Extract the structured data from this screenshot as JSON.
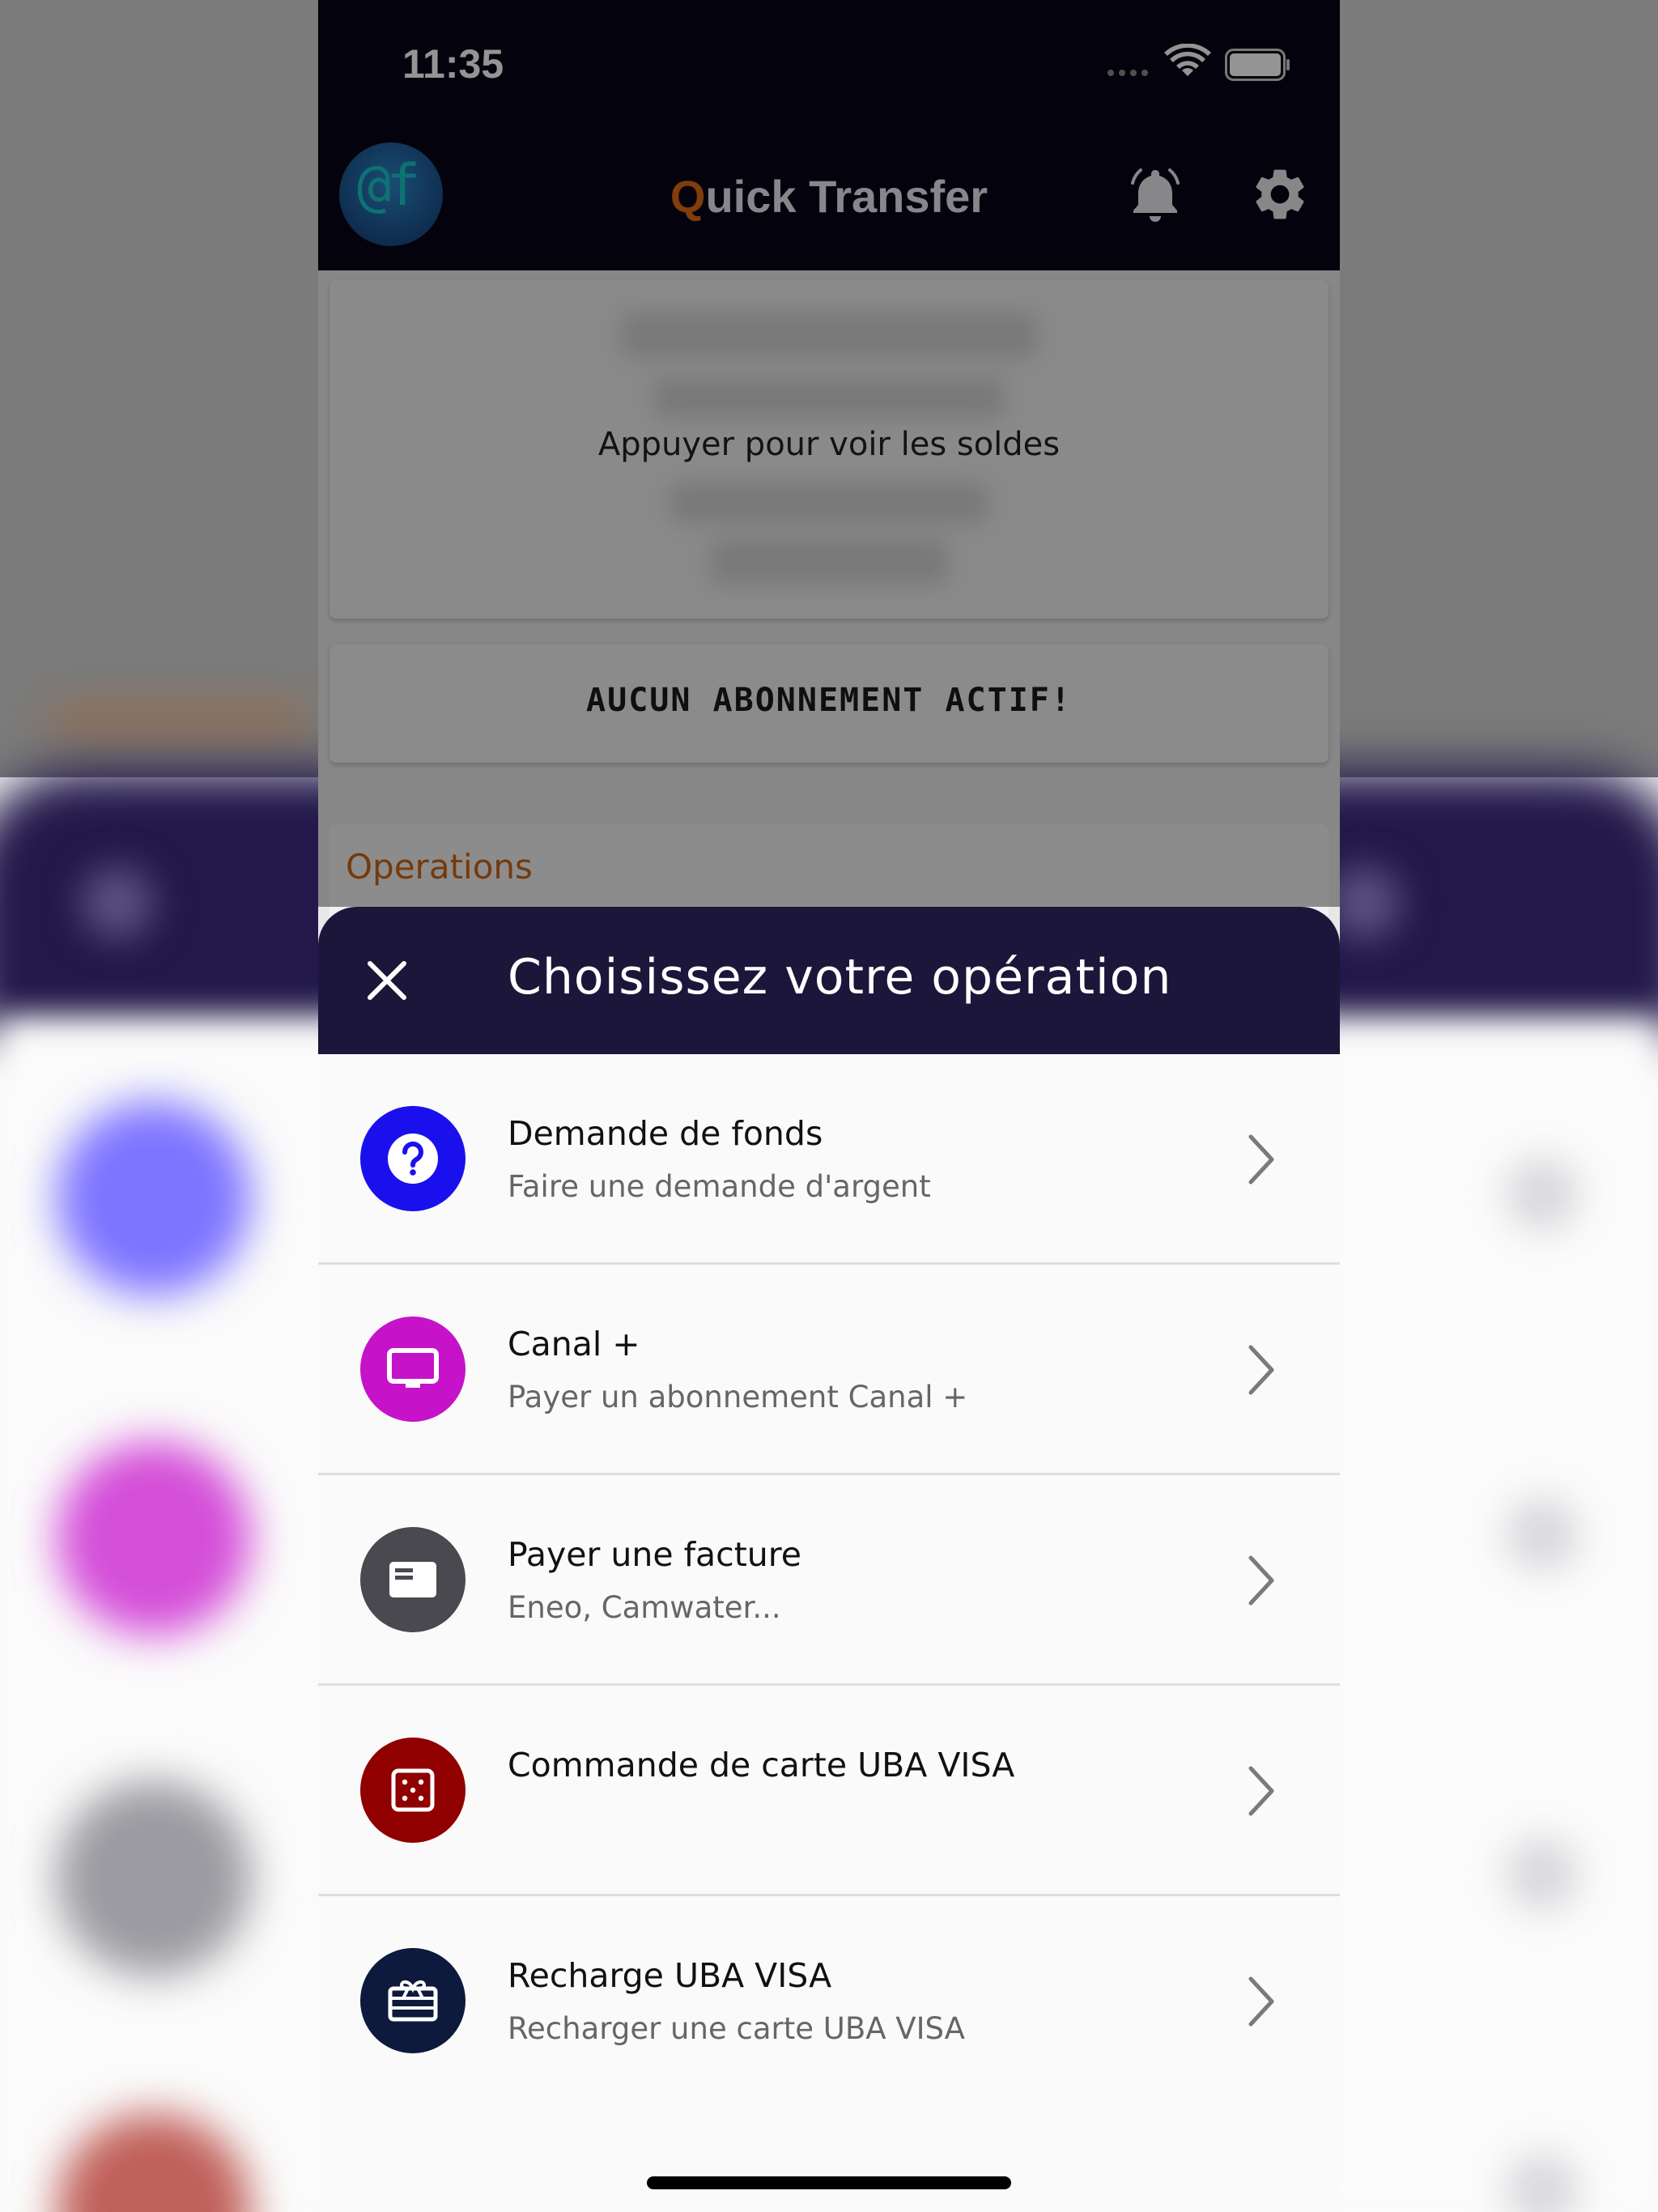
{
  "status_bar": {
    "time": "11:35"
  },
  "app_bar": {
    "logo_text": "@f",
    "title_accent": "Q",
    "title_rest": "uick Transfer"
  },
  "balance_card": {
    "text": "Appuyer pour voir les soldes"
  },
  "subscription": {
    "text": "AUCUN ABONNEMENT ACTIF!"
  },
  "operations_section": {
    "title": "Operations"
  },
  "sheet": {
    "title": "Choisissez votre opération",
    "items": [
      {
        "title": "Demande de fonds",
        "subtitle": "Faire une demande d'argent",
        "icon": "help-circle-icon",
        "color": "#1a10ee"
      },
      {
        "title": "Canal +",
        "subtitle": "Payer un abonnement Canal +",
        "icon": "tv-icon",
        "color": "#c612c9"
      },
      {
        "title": "Payer une facture",
        "subtitle": "Eneo, Camwater...",
        "icon": "bill-card-icon",
        "color": "#4a4950"
      },
      {
        "title": "Commande de carte UBA VISA",
        "subtitle": "",
        "icon": "dice-icon",
        "color": "#900000"
      },
      {
        "title": "Recharge UBA VISA",
        "subtitle": "Recharger une carte UBA VISA",
        "icon": "gift-card-icon",
        "color": "#0d1a3d"
      }
    ]
  },
  "colors": {
    "app_bar_bg": "#080618",
    "sheet_header_bg": "#1c163b",
    "accent_orange": "#e06a16"
  }
}
